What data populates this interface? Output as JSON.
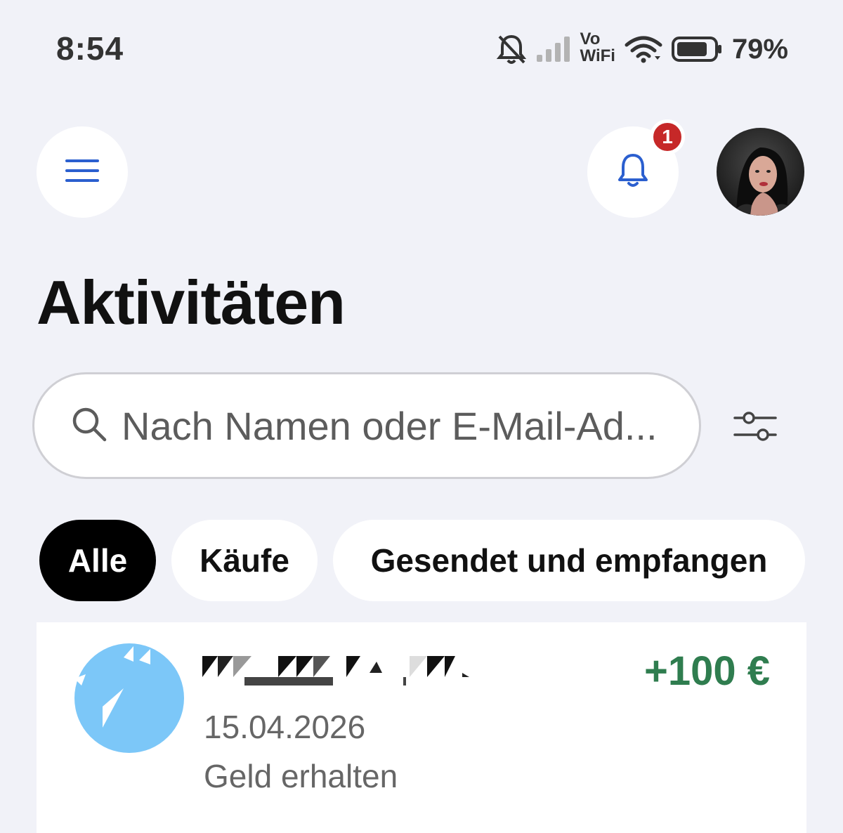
{
  "status_bar": {
    "time": "8:54",
    "vowifi_top": "Vo",
    "vowifi_bottom": "WiFi",
    "battery_percent": "79%",
    "icons": [
      "bell-muted-icon",
      "signal-icon",
      "vowifi-icon",
      "wifi-icon",
      "battery-icon"
    ]
  },
  "header": {
    "menu_icon": "hamburger-menu-icon",
    "bell_icon": "bell-icon",
    "notification_count": "1",
    "avatar": "profile-avatar"
  },
  "page": {
    "title": "Aktivitäten"
  },
  "search": {
    "placeholder": "Nach Namen oder E-Mail-Ad...",
    "value": "",
    "filter_icon": "filter-sliders-icon"
  },
  "filters": {
    "chips": [
      {
        "label": "Alle",
        "selected": true
      },
      {
        "label": "Käufe",
        "selected": false
      },
      {
        "label": "Gesendet und empfangen",
        "selected": false
      }
    ]
  },
  "transactions": [
    {
      "name": "",
      "amount": "+100 €",
      "date": "15.04.2026",
      "type": "Geld erhalten",
      "amount_color": "#2f7d4f"
    }
  ],
  "colors": {
    "background": "#f1f2f8",
    "accent_blue": "#2b5fcf",
    "badge_red": "#c62828",
    "positive_green": "#2f7d4f"
  }
}
